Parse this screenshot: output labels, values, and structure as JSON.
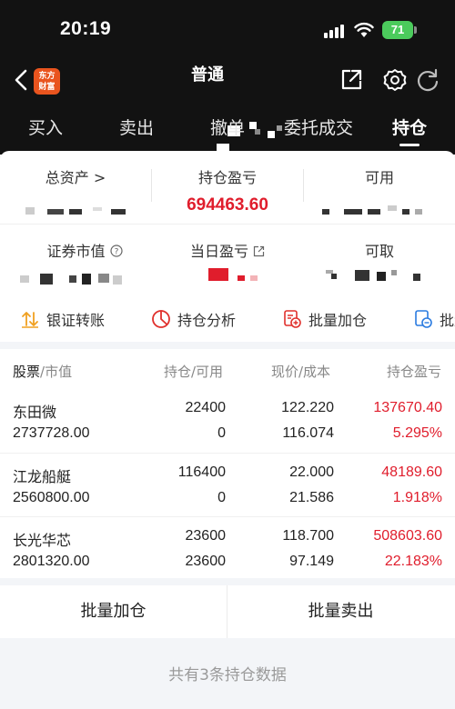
{
  "status_bar": {
    "time": "20:19",
    "battery": "71"
  },
  "nav": {
    "title": "普通"
  },
  "tabs": [
    {
      "label": "买入",
      "active": false
    },
    {
      "label": "卖出",
      "active": false
    },
    {
      "label": "撤单",
      "active": false
    },
    {
      "label": "委托成交",
      "active": false
    },
    {
      "label": "持仓",
      "active": true
    }
  ],
  "summary": {
    "total_assets_label": "总资产 >",
    "holding_pnl_label": "持仓盈亏",
    "holding_pnl_value": "694463.60",
    "available_label": "可用",
    "market_value_label": "证券市值",
    "today_pnl_label": "当日盈亏",
    "withdrawable_label": "可取"
  },
  "quick_actions": [
    {
      "label": "银证转账",
      "icon": "transfer-icon"
    },
    {
      "label": "持仓分析",
      "icon": "pie-chart-icon"
    },
    {
      "label": "批量加仓",
      "icon": "batch-add-icon"
    },
    {
      "label": "批量",
      "icon": "batch-icon"
    }
  ],
  "table": {
    "headers": {
      "stock": "股票",
      "market_value": "/市值",
      "position": "持仓/可用",
      "price": "现价/成本",
      "pnl": "持仓盈亏"
    },
    "rows": [
      {
        "name": "东田微",
        "market_value": "2737728.00",
        "position": "22400",
        "available": "0",
        "price": "122.220",
        "cost": "116.074",
        "pnl": "137670.40",
        "pnl_pct": "5.295%"
      },
      {
        "name": "江龙船艇",
        "market_value": "2560800.00",
        "position": "116400",
        "available": "0",
        "price": "22.000",
        "cost": "21.586",
        "pnl": "48189.60",
        "pnl_pct": "1.918%"
      },
      {
        "name": "长光华芯",
        "market_value": "2801320.00",
        "position": "23600",
        "available": "23600",
        "price": "118.700",
        "cost": "97.149",
        "pnl": "508603.60",
        "pnl_pct": "22.183%"
      }
    ]
  },
  "bottom_buttons": {
    "batch_add": "批量加仓",
    "batch_sell": "批量卖出"
  },
  "footer": {
    "note": "共有3条持仓数据"
  },
  "colors": {
    "header_bg": "#121212",
    "accent_red": "#e01d2c",
    "battery_green": "#4bcb5c",
    "logo_orange": "#e9541e"
  }
}
